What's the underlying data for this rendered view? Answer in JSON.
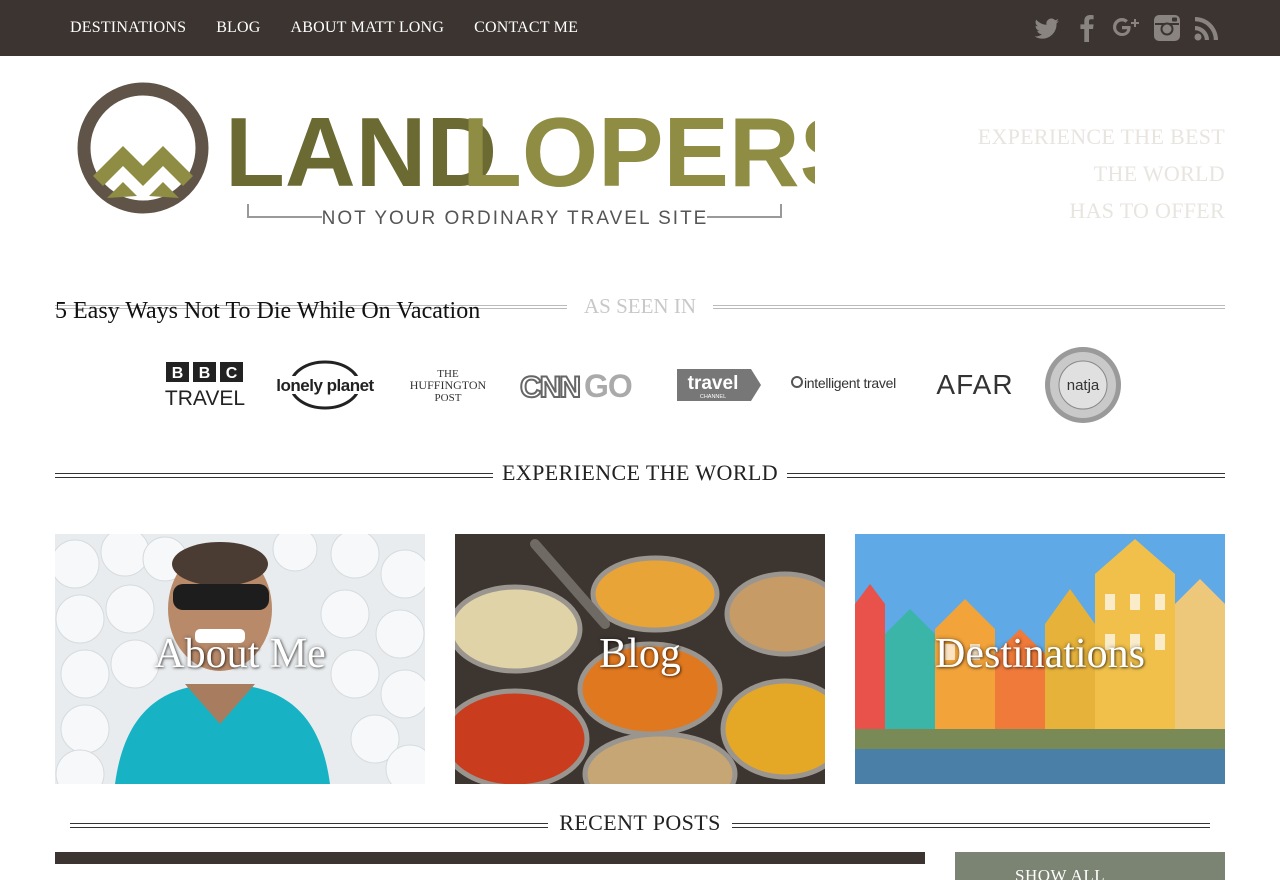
{
  "nav": {
    "items": [
      {
        "label": "DESTINATIONS"
      },
      {
        "label": "BLOG"
      },
      {
        "label": "ABOUT MATT LONG"
      },
      {
        "label": "CONTACT ME"
      }
    ]
  },
  "social": {
    "icons": [
      "twitter-icon",
      "facebook-icon",
      "google-plus-icon",
      "instagram-icon",
      "rss-icon"
    ],
    "color": "#8a8480"
  },
  "logo": {
    "word_dark": "LAND",
    "word_light": "LOPERS",
    "subtitle": "NOT YOUR ORDINARY TRAVEL SITE",
    "colors": {
      "ring": "#5f5447",
      "dark": "#6b6a32",
      "light": "#8f8c43",
      "sub": "#555"
    }
  },
  "tagline": {
    "lines": [
      "EXPERIENCE THE BEST",
      "THE WORLD",
      "HAS TO OFFER"
    ]
  },
  "featured_post": {
    "title": "5 Easy Ways Not To Die While On Vacation"
  },
  "as_seen_in": {
    "title": "AS SEEN IN",
    "logos": [
      {
        "name": "bbc-travel-logo",
        "line1": "BBC",
        "line2": "TRAVEL"
      },
      {
        "name": "lonely-planet-logo",
        "text": "lonely planet"
      },
      {
        "name": "huffington-post-logo",
        "line1": "THE",
        "line2": "HUFFINGTON",
        "line3": "POST"
      },
      {
        "name": "cnn-go-logo",
        "text": "CNN",
        "text2": "GO"
      },
      {
        "name": "travel-channel-logo",
        "text": "travel",
        "text2": "CHANNEL"
      },
      {
        "name": "intelligent-travel-logo",
        "text": "intelligent travel"
      },
      {
        "name": "afar-logo",
        "text": "AFAR"
      },
      {
        "name": "natja-award-logo",
        "text": "natja"
      }
    ]
  },
  "sections": {
    "experience_title": "EXPERIENCE THE WORLD",
    "recent_title": "RECENT POSTS"
  },
  "cards": [
    {
      "label": "About Me"
    },
    {
      "label": "Blog"
    },
    {
      "label": "Destinations"
    }
  ],
  "recent": {
    "show_all": "SHOW ALL"
  }
}
